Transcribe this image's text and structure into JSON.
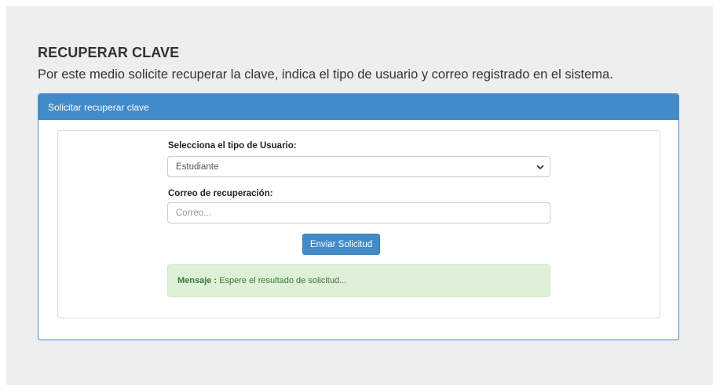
{
  "page": {
    "title": "RECUPERAR CLAVE",
    "lead": "Por este medio solicite recuperar la clave, indica el tipo de usuario y correo registrado en el sistema."
  },
  "panel": {
    "heading": "Solicitar recuperar clave"
  },
  "form": {
    "user_type_label": "Selecciona el tipo de Usuario:",
    "user_type_selected": "Estudiante",
    "email_label": "Correo de recuperación:",
    "email_value": "",
    "email_placeholder": "Correo...",
    "submit_label": "Enviar Solicitud"
  },
  "alert": {
    "label": "Mensaje :",
    "text": " Espere el resultado de solicitud..."
  },
  "icons": {
    "select_arrow": "chevron-down-icon"
  },
  "colors": {
    "primary": "#428bca",
    "success_bg": "#dff0d8",
    "success_text": "#3c763d",
    "page_bg": "#eeeeee"
  }
}
